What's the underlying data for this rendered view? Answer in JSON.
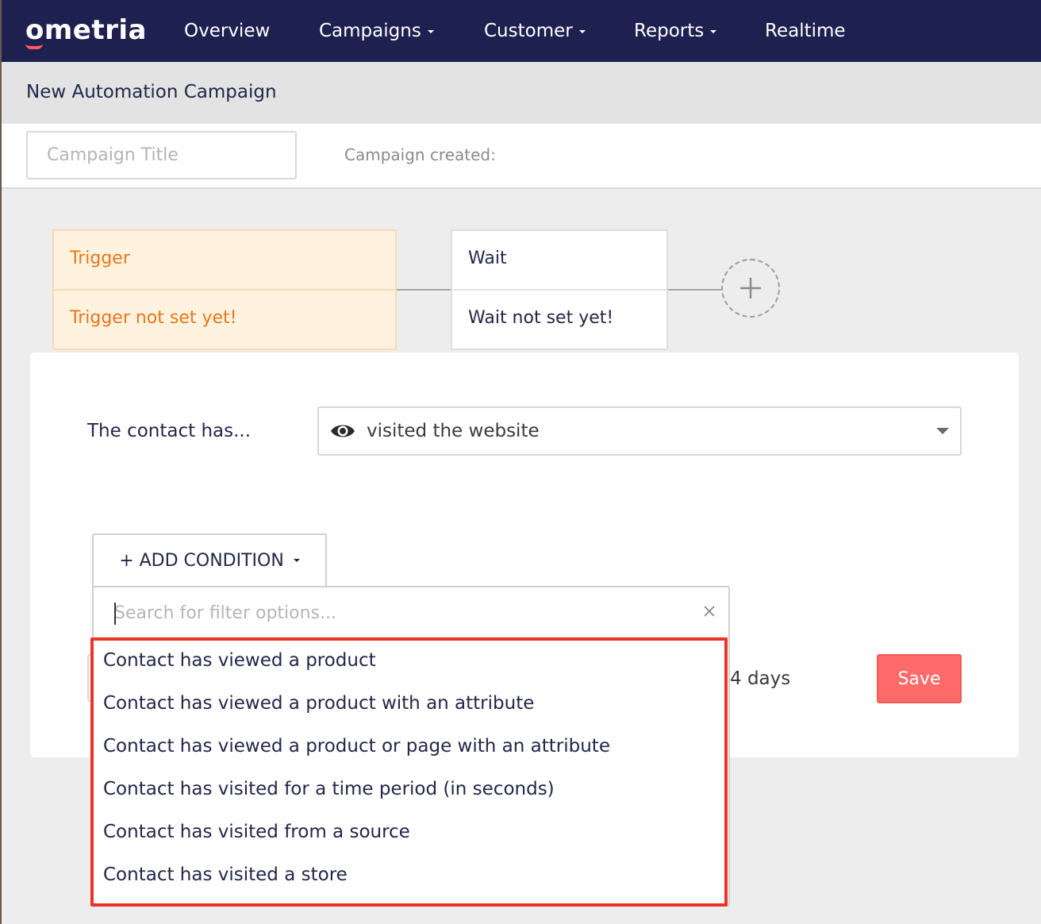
{
  "app": {
    "logo_text": "ometria",
    "nav": [
      {
        "label": "Overview",
        "has_caret": false
      },
      {
        "label": "Campaigns",
        "has_caret": true
      },
      {
        "label": "Customer",
        "has_caret": true
      },
      {
        "label": "Reports",
        "has_caret": true
      },
      {
        "label": "Realtime",
        "has_caret": false
      }
    ]
  },
  "page": {
    "title": "New Automation Campaign",
    "campaign_title_placeholder": "Campaign Title",
    "campaign_created_label": "Campaign created:"
  },
  "flow": {
    "trigger": {
      "title": "Trigger",
      "status": "Trigger not set yet!"
    },
    "wait": {
      "title": "Wait",
      "status": "Wait not set yet!"
    },
    "add_step_icon": "plus-icon"
  },
  "panel": {
    "contact_label": "The contact has...",
    "behaviour_select": {
      "icon": "eye-icon",
      "value": "visited the website"
    },
    "add_condition_label": "+ ADD CONDITION",
    "days_text": "4 days",
    "save_label": "Save"
  },
  "dropdown": {
    "search_placeholder": "Search for filter options...",
    "clear_icon": "close-icon",
    "options": [
      "Contact has viewed a product",
      "Contact has viewed a product with an attribute",
      "Contact has viewed a product or page with an attribute",
      "Contact has visited for a time period (in seconds)",
      "Contact has visited from a source",
      "Contact has visited a store"
    ]
  },
  "colors": {
    "nav_bg": "#1e2050",
    "brand_accent": "#ff5a5f",
    "trigger_orange": "#e8771c",
    "save_button": "#ff6b6b",
    "highlight_red": "#ec3424"
  }
}
